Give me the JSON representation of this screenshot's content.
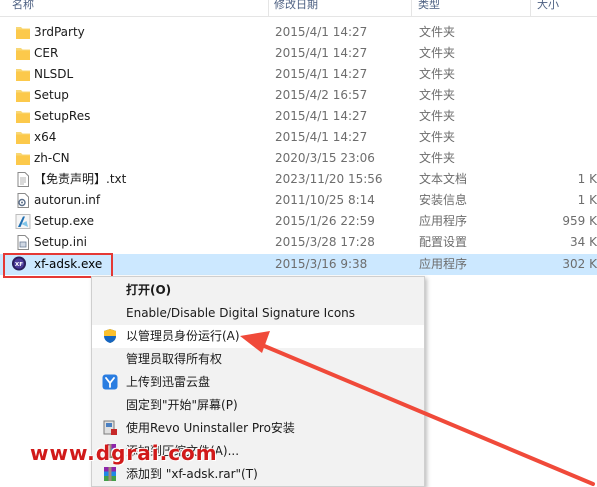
{
  "columns": {
    "name": "名称",
    "date": "修改日期",
    "type": "类型",
    "size": "大小"
  },
  "files": [
    {
      "name": "3rdParty",
      "date": "2015/4/1 14:27",
      "type": "文件夹",
      "size": "",
      "icon": "folder-icon"
    },
    {
      "name": "CER",
      "date": "2015/4/1 14:27",
      "type": "文件夹",
      "size": "",
      "icon": "folder-icon"
    },
    {
      "name": "NLSDL",
      "date": "2015/4/1 14:27",
      "type": "文件夹",
      "size": "",
      "icon": "folder-icon"
    },
    {
      "name": "Setup",
      "date": "2015/4/2 16:57",
      "type": "文件夹",
      "size": "",
      "icon": "folder-icon"
    },
    {
      "name": "SetupRes",
      "date": "2015/4/1 14:27",
      "type": "文件夹",
      "size": "",
      "icon": "folder-icon"
    },
    {
      "name": "x64",
      "date": "2015/4/1 14:27",
      "type": "文件夹",
      "size": "",
      "icon": "folder-icon"
    },
    {
      "name": "zh-CN",
      "date": "2020/3/15 23:06",
      "type": "文件夹",
      "size": "",
      "icon": "folder-icon"
    },
    {
      "name": "【免责声明】.txt",
      "date": "2023/11/20 15:56",
      "type": "文本文档",
      "size": "1 K",
      "icon": "text-file-icon"
    },
    {
      "name": "autorun.inf",
      "date": "2011/10/25 8:14",
      "type": "安装信息",
      "size": "1 K",
      "icon": "setup-info-icon"
    },
    {
      "name": "Setup.exe",
      "date": "2015/1/26 22:59",
      "type": "应用程序",
      "size": "959 K",
      "icon": "autodesk-app-icon"
    },
    {
      "name": "Setup.ini",
      "date": "2015/3/28 17:28",
      "type": "配置设置",
      "size": "34 K",
      "icon": "ini-file-icon"
    },
    {
      "name": "xf-adsk.exe",
      "date": "2015/3/16 9:38",
      "type": "应用程序",
      "size": "302 K",
      "icon": "keygen-app-icon"
    }
  ],
  "context_menu": {
    "items": [
      {
        "label": "打开(O)",
        "icon": ""
      },
      {
        "label": "Enable/Disable Digital Signature Icons",
        "icon": ""
      },
      {
        "label": "以管理员身份运行(A)",
        "icon": "uac-shield-icon"
      },
      {
        "label": "管理员取得所有权",
        "icon": ""
      },
      {
        "label": "上传到迅雷云盘",
        "icon": "xunlei-icon"
      },
      {
        "label": "固定到\"开始\"屏幕(P)",
        "icon": ""
      },
      {
        "label": "使用Revo Uninstaller Pro安装",
        "icon": "revo-icon"
      },
      {
        "label": "添加到压缩文件(A)...",
        "icon": "winrar-icon"
      },
      {
        "label": "添加到 \"xf-adsk.rar\"(T)",
        "icon": "winrar-icon"
      }
    ]
  },
  "watermark": "www.dgrai.com",
  "colors": {
    "selection": "#cce8ff",
    "highlight_box": "#e53935",
    "arrow": "#f04a3a",
    "watermark": "#d11a1a"
  }
}
